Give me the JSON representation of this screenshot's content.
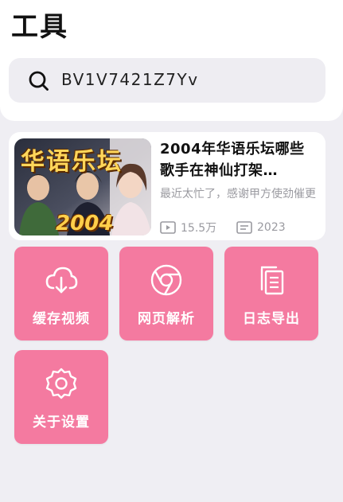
{
  "page": {
    "title": "工具"
  },
  "search": {
    "value": "BV1V7421Z7Yv"
  },
  "video": {
    "thumbnail_text_top": "华语乐坛",
    "thumbnail_text_bottom": "2004",
    "title": "2004年华语乐坛哪些歌手在神仙打架…",
    "description": "最近太忙了，感谢甲方使劲催更",
    "views": "15.5万",
    "year": "2023",
    "icons": {
      "views": "play-count-icon",
      "year": "list-date-icon"
    }
  },
  "tools": [
    {
      "label": "缓存视频",
      "icon": "cloud-download-icon"
    },
    {
      "label": "网页解析",
      "icon": "chrome-browser-icon"
    },
    {
      "label": "日志导出",
      "icon": "document-copy-icon"
    },
    {
      "label": "关于设置",
      "icon": "gear-icon"
    }
  ],
  "colors": {
    "tile": "#f47aa0",
    "background": "#efeef3",
    "card": "#ffffff"
  }
}
